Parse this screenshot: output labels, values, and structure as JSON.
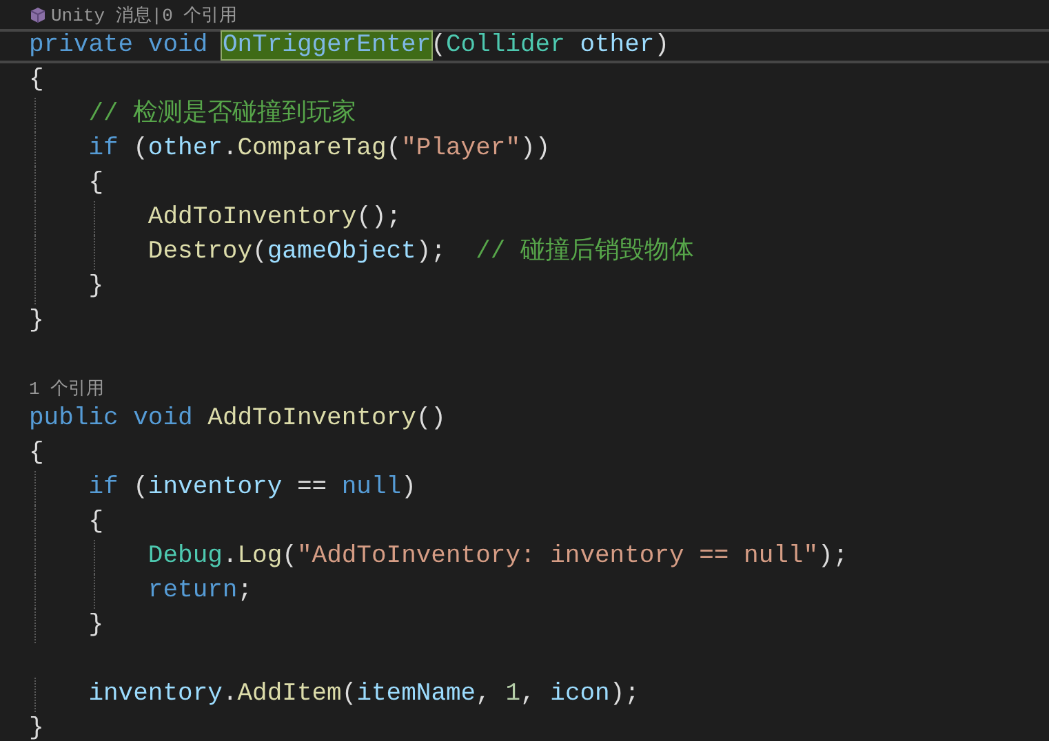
{
  "editor": {
    "lines": [
      {
        "kind": "codelens",
        "icon": true,
        "text": "Unity 消息|0 个引用"
      },
      {
        "kind": "code",
        "current": true,
        "tokens": [
          {
            "kind": "keyword",
            "text": "private "
          },
          {
            "kind": "keyword",
            "text": "void "
          },
          {
            "kind": "method",
            "text": "OnTriggerEnter",
            "highlighted": true
          },
          {
            "kind": "plain",
            "text": "("
          },
          {
            "kind": "type",
            "text": "Collider "
          },
          {
            "kind": "variable",
            "text": "other"
          },
          {
            "kind": "plain",
            "text": ")"
          }
        ]
      },
      {
        "kind": "code",
        "current": false,
        "tokens": [
          {
            "kind": "plain",
            "text": "{"
          }
        ]
      },
      {
        "kind": "code",
        "current": false,
        "tokens": [
          {
            "kind": "comment",
            "text": "    // 检测是否碰撞到玩家"
          }
        ]
      },
      {
        "kind": "code",
        "current": false,
        "tokens": [
          {
            "kind": "keyword",
            "text": "    if"
          },
          {
            "kind": "plain",
            "text": " ("
          },
          {
            "kind": "variable",
            "text": "other"
          },
          {
            "kind": "plain",
            "text": "."
          },
          {
            "kind": "method",
            "text": "CompareTag"
          },
          {
            "kind": "plain",
            "text": "("
          },
          {
            "kind": "string",
            "text": "\"Player\""
          },
          {
            "kind": "plain",
            "text": "))"
          }
        ]
      },
      {
        "kind": "code",
        "current": false,
        "tokens": [
          {
            "kind": "plain",
            "text": "    {"
          }
        ]
      },
      {
        "kind": "code",
        "current": false,
        "tokens": [
          {
            "kind": "method",
            "text": "        AddToInventory"
          },
          {
            "kind": "plain",
            "text": "();"
          }
        ]
      },
      {
        "kind": "code",
        "current": false,
        "tokens": [
          {
            "kind": "method",
            "text": "        Destroy"
          },
          {
            "kind": "plain",
            "text": "("
          },
          {
            "kind": "variable",
            "text": "gameObject"
          },
          {
            "kind": "plain",
            "text": ");  "
          },
          {
            "kind": "comment",
            "text": "// 碰撞后销毁物体"
          }
        ]
      },
      {
        "kind": "code",
        "current": false,
        "tokens": [
          {
            "kind": "plain",
            "text": "    }"
          }
        ]
      },
      {
        "kind": "code",
        "current": false,
        "tokens": [
          {
            "kind": "plain",
            "text": "}"
          }
        ]
      },
      {
        "kind": "blank"
      },
      {
        "kind": "codelens",
        "icon": false,
        "text": "1 个引用"
      },
      {
        "kind": "code",
        "current": false,
        "tokens": [
          {
            "kind": "keyword",
            "text": "public "
          },
          {
            "kind": "keyword",
            "text": "void "
          },
          {
            "kind": "method",
            "text": "AddToInventory"
          },
          {
            "kind": "plain",
            "text": "()"
          }
        ]
      },
      {
        "kind": "code",
        "current": false,
        "tokens": [
          {
            "kind": "plain",
            "text": "{"
          }
        ]
      },
      {
        "kind": "code",
        "current": false,
        "tokens": [
          {
            "kind": "keyword",
            "text": "    if"
          },
          {
            "kind": "plain",
            "text": " ("
          },
          {
            "kind": "variable",
            "text": "inventory"
          },
          {
            "kind": "plain",
            "text": " == "
          },
          {
            "kind": "keyword",
            "text": "null"
          },
          {
            "kind": "plain",
            "text": ")"
          }
        ]
      },
      {
        "kind": "code",
        "current": false,
        "tokens": [
          {
            "kind": "plain",
            "text": "    {"
          }
        ]
      },
      {
        "kind": "code",
        "current": false,
        "tokens": [
          {
            "kind": "type",
            "text": "        Debug"
          },
          {
            "kind": "plain",
            "text": "."
          },
          {
            "kind": "method",
            "text": "Log"
          },
          {
            "kind": "plain",
            "text": "("
          },
          {
            "kind": "string",
            "text": "\"AddToInventory: inventory == null\""
          },
          {
            "kind": "plain",
            "text": ");"
          }
        ]
      },
      {
        "kind": "code",
        "current": false,
        "tokens": [
          {
            "kind": "keyword",
            "text": "        return"
          },
          {
            "kind": "plain",
            "text": ";"
          }
        ]
      },
      {
        "kind": "code",
        "current": false,
        "tokens": [
          {
            "kind": "plain",
            "text": "    }"
          }
        ]
      },
      {
        "kind": "blank"
      },
      {
        "kind": "code",
        "current": false,
        "tokens": [
          {
            "kind": "variable",
            "text": "    inventory"
          },
          {
            "kind": "plain",
            "text": "."
          },
          {
            "kind": "method",
            "text": "AddItem"
          },
          {
            "kind": "plain",
            "text": "("
          },
          {
            "kind": "variable",
            "text": "itemName"
          },
          {
            "kind": "plain",
            "text": ", "
          },
          {
            "kind": "number",
            "text": "1"
          },
          {
            "kind": "plain",
            "text": ", "
          },
          {
            "kind": "variable",
            "text": "icon"
          },
          {
            "kind": "plain",
            "text": ");"
          }
        ]
      },
      {
        "kind": "code",
        "current": false,
        "tokens": [
          {
            "kind": "plain",
            "text": "}"
          }
        ]
      }
    ]
  }
}
